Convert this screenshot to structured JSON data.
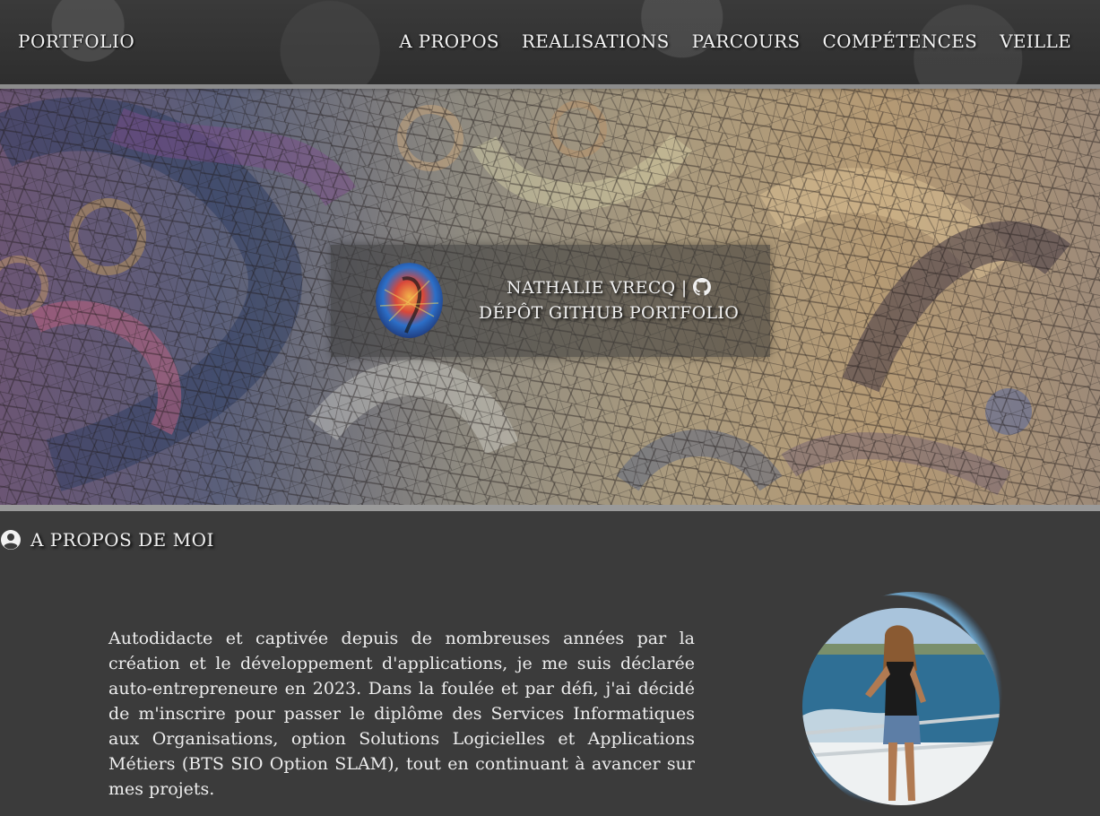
{
  "nav": {
    "brand": "PORTFOLIO",
    "links": [
      "A PROPOS",
      "REALISATIONS",
      "PARCOURS",
      "COMPÉTENCES",
      "VEILLE"
    ]
  },
  "hero": {
    "name": "NATHALIE VRECQ |",
    "github_link": "DÉPÔT GITHUB PORTFOLIO",
    "icons": [
      "avatar-mosaic",
      "github-icon"
    ]
  },
  "about": {
    "title": "A PROPOS DE MOI",
    "icon": "user-circle-icon",
    "text": "Autodidacte et captivée depuis de nombreuses années par la création et le développement d'applications, je me suis déclarée auto-entrepreneure en 2023. Dans la foulée et par défi, j'ai décidé de m'inscrire pour passer le diplôme des Services Informatiques aux Organisations, option Solutions Logicielles et Applications Métiers (BTS SIO Option SLAM), tout en continuant à avancer sur mes projets."
  },
  "colors": {
    "background": "#3b3b3b",
    "text": "#f0f0f0",
    "ring": "#6fa8cf"
  }
}
